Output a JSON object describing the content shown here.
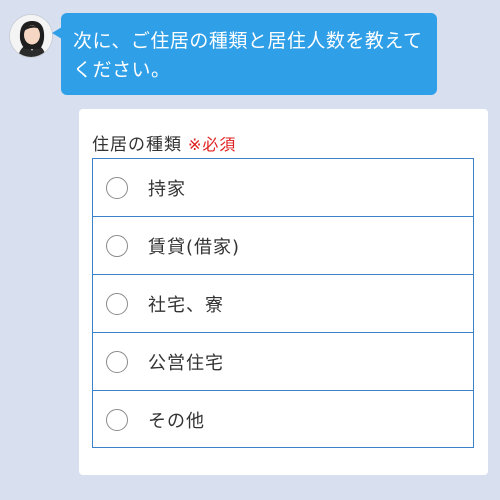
{
  "chat": {
    "message": "次に、ご住居の種類と居住人数を教えてください。"
  },
  "form": {
    "label": "住居の種類",
    "required": "※必須",
    "options": [
      {
        "label": "持家"
      },
      {
        "label": "賃貸(借家)"
      },
      {
        "label": "社宅、寮"
      },
      {
        "label": "公営住宅"
      },
      {
        "label": "その他"
      }
    ]
  },
  "colors": {
    "background": "#d8e0ef",
    "bubble": "#2f9fe8",
    "option_border": "#3b82c9",
    "required": "#e02020"
  },
  "icons": {
    "avatar": "operator-avatar",
    "radio": "radio-unselected"
  }
}
